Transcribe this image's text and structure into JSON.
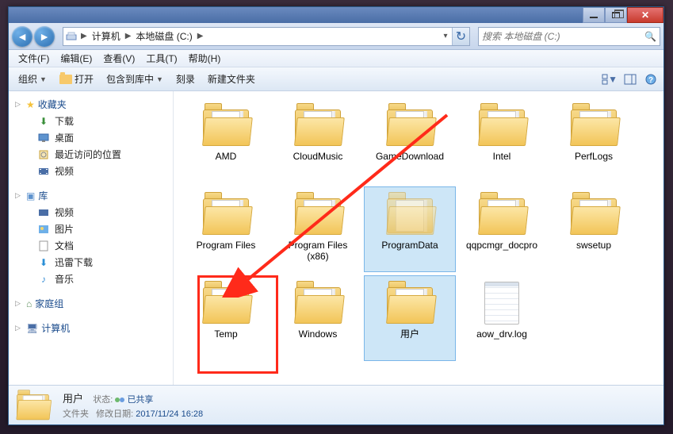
{
  "address": {
    "crumbs": [
      "计算机",
      "本地磁盘 (C:)"
    ]
  },
  "search": {
    "placeholder": "搜索 本地磁盘 (C:)"
  },
  "menu": {
    "file": "文件(F)",
    "edit": "编辑(E)",
    "view": "查看(V)",
    "tools": "工具(T)",
    "help": "帮助(H)"
  },
  "toolbar": {
    "organize": "组织",
    "open": "打开",
    "include": "包含到库中",
    "burn": "刻录",
    "newfolder": "新建文件夹"
  },
  "sidebar": {
    "fav": "收藏夹",
    "fav_items": [
      "下载",
      "桌面",
      "最近访问的位置",
      "视频"
    ],
    "lib": "库",
    "lib_items": [
      "视频",
      "图片",
      "文档",
      "迅雷下载",
      "音乐"
    ],
    "homegrp": "家庭组",
    "computer": "计算机"
  },
  "items": [
    {
      "name": "AMD",
      "type": "folder"
    },
    {
      "name": "CloudMusic",
      "type": "folder"
    },
    {
      "name": "GameDownload",
      "type": "folder"
    },
    {
      "name": "Intel",
      "type": "folder"
    },
    {
      "name": "PerfLogs",
      "type": "folder"
    },
    {
      "name": "Program Files",
      "type": "folder"
    },
    {
      "name": "Program Files (x86)",
      "type": "folder"
    },
    {
      "name": "ProgramData",
      "type": "folder-hidden",
      "selected": true
    },
    {
      "name": "qqpcmgr_docpro",
      "type": "folder"
    },
    {
      "name": "swsetup",
      "type": "folder"
    },
    {
      "name": "Temp",
      "type": "folder"
    },
    {
      "name": "Windows",
      "type": "folder"
    },
    {
      "name": "用户",
      "type": "folder",
      "selected": true
    },
    {
      "name": "aow_drv.log",
      "type": "log"
    }
  ],
  "details": {
    "name": "用户",
    "type_label": "文件夹",
    "state_label": "状态:",
    "state_value": "已共享",
    "mod_label": "修改日期:",
    "mod_value": "2017/11/24 16:28"
  }
}
